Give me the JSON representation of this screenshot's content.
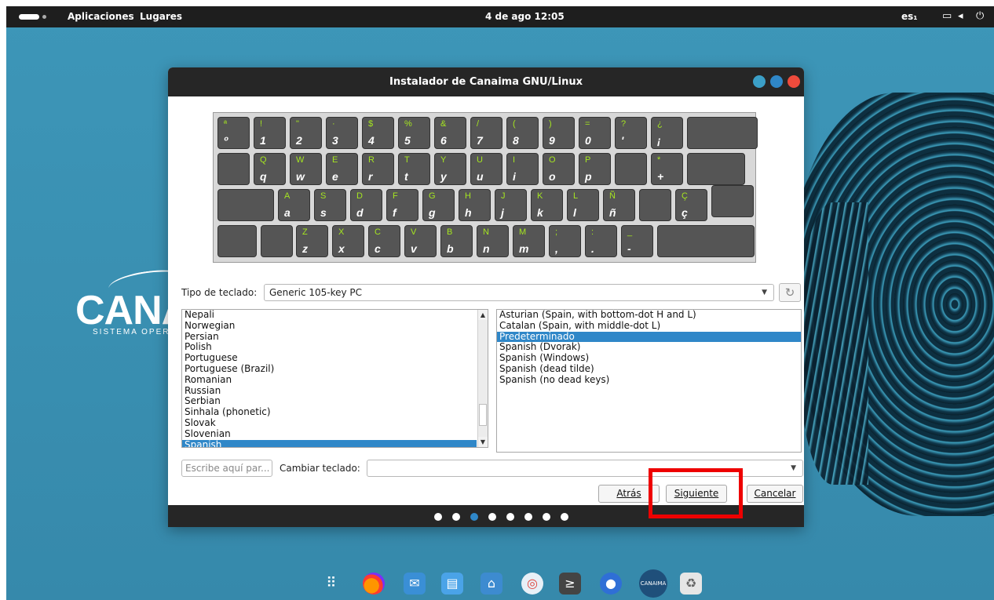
{
  "topbar": {
    "activities": "Aplicaciones",
    "places": "Lugares",
    "clock": "4 de ago  12:05",
    "input_method": "es₁"
  },
  "desktop": {
    "logo_text": "CANA",
    "logo_subtitle": "SISTEMA OPERAT"
  },
  "window": {
    "title": "Instalador de Canaima GNU/Linux",
    "keyboard": {
      "rows": [
        [
          {
            "t": "ª",
            "b": "º"
          },
          {
            "t": "!",
            "b": "1"
          },
          {
            "t": "\"",
            "b": "2"
          },
          {
            "t": "·",
            "b": "3"
          },
          {
            "t": "$",
            "b": "4"
          },
          {
            "t": "%",
            "b": "5"
          },
          {
            "t": "&",
            "b": "6"
          },
          {
            "t": "/",
            "b": "7"
          },
          {
            "t": "(",
            "b": "8"
          },
          {
            "t": ")",
            "b": "9"
          },
          {
            "t": "=",
            "b": "0"
          },
          {
            "t": "?",
            "b": "'"
          },
          {
            "t": "¿",
            "b": "¡"
          }
        ],
        [
          {
            "t": "Q",
            "b": "q"
          },
          {
            "t": "W",
            "b": "w"
          },
          {
            "t": "E",
            "b": "e"
          },
          {
            "t": "R",
            "b": "r"
          },
          {
            "t": "T",
            "b": "t"
          },
          {
            "t": "Y",
            "b": "y"
          },
          {
            "t": "U",
            "b": "u"
          },
          {
            "t": "I",
            "b": "i"
          },
          {
            "t": "O",
            "b": "o"
          },
          {
            "t": "P",
            "b": "p"
          },
          {
            "t": "",
            "b": ""
          },
          {
            "t": "*",
            "b": "+"
          }
        ],
        [
          {
            "t": "A",
            "b": "a"
          },
          {
            "t": "S",
            "b": "s"
          },
          {
            "t": "D",
            "b": "d"
          },
          {
            "t": "F",
            "b": "f"
          },
          {
            "t": "G",
            "b": "g"
          },
          {
            "t": "H",
            "b": "h"
          },
          {
            "t": "J",
            "b": "j"
          },
          {
            "t": "K",
            "b": "k"
          },
          {
            "t": "L",
            "b": "l"
          },
          {
            "t": "Ñ",
            "b": "ñ"
          },
          {
            "t": "",
            "b": ""
          },
          {
            "t": "Ç",
            "b": "ç"
          }
        ],
        [
          {
            "t": "Z",
            "b": "z"
          },
          {
            "t": "X",
            "b": "x"
          },
          {
            "t": "C",
            "b": "c"
          },
          {
            "t": "V",
            "b": "v"
          },
          {
            "t": "B",
            "b": "b"
          },
          {
            "t": "N",
            "b": "n"
          },
          {
            "t": "M",
            "b": "m"
          },
          {
            "t": ";",
            "b": ","
          },
          {
            "t": ":",
            "b": "."
          },
          {
            "t": "_",
            "b": "-"
          }
        ]
      ]
    },
    "keyboard_type_label": "Tipo de teclado:",
    "keyboard_type_value": "Generic 105-key PC",
    "languages": [
      "Nepali",
      "Norwegian",
      "Persian",
      "Polish",
      "Portuguese",
      "Portuguese (Brazil)",
      "Romanian",
      "Russian",
      "Serbian",
      "Sinhala (phonetic)",
      "Slovak",
      "Slovenian",
      "Spanish"
    ],
    "selected_language": "Spanish",
    "variants": [
      "Asturian (Spain, with bottom-dot H and L)",
      "Catalan (Spain, with middle-dot L)",
      "Predeterminado",
      "Spanish (Dvorak)",
      "Spanish (Windows)",
      "Spanish (dead tilde)",
      "Spanish (no dead keys)"
    ],
    "selected_variant": "Predeterminado",
    "search_placeholder": "Escribe aquí par...",
    "change_keyboard_label": "Cambiar teclado:",
    "change_keyboard_value": "",
    "buttons": {
      "back": "Atrás",
      "next": "Siguiente",
      "cancel": "Cancelar"
    },
    "progress": {
      "total_steps": 8,
      "current_step": 3
    }
  },
  "colors": {
    "selection": "#2f87c8",
    "key_accent": "#a5e620",
    "highlight": "#ee0000"
  },
  "dock": [
    "apps-grid-icon",
    "firefox-icon",
    "mail-icon",
    "text-editor-icon",
    "files-icon",
    "help-icon",
    "terminal-icon",
    "settings-toggle-icon",
    "canaima-installer-icon",
    "trash-icon"
  ]
}
